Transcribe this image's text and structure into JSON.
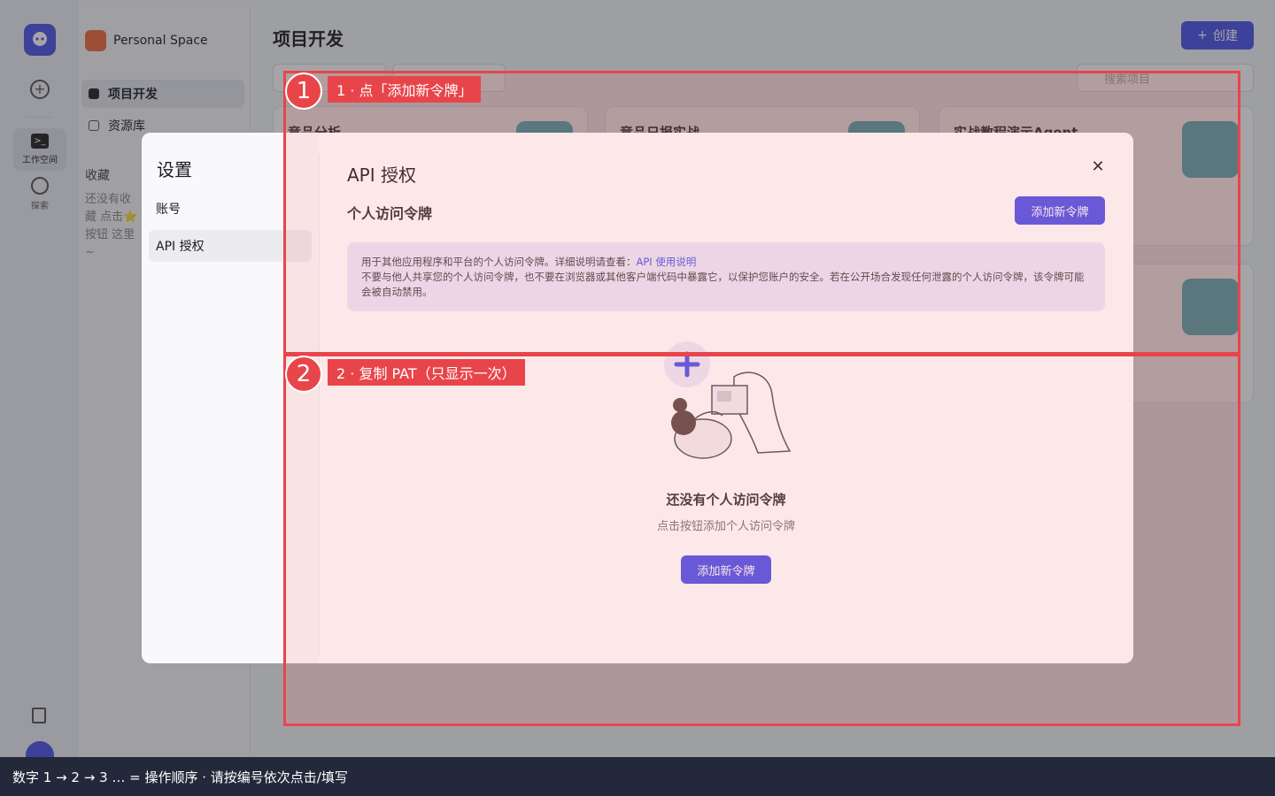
{
  "rail": {
    "workspace_label": "工作空间",
    "explore_label": "探索"
  },
  "sidebar": {
    "space_name": "Personal Space",
    "items": [
      {
        "label": "项目开发"
      },
      {
        "label": "资源库"
      }
    ],
    "favorites_title": "收藏",
    "favorites_empty": "还没有收藏 点击⭐按钮 这里~"
  },
  "main": {
    "title": "项目开发",
    "create_label": "创建",
    "search_placeholder": "搜索项目",
    "cards": [
      {
        "title": "竞品分析"
      },
      {
        "title": "竞品日报实战"
      },
      {
        "title": "实战教程演示Agent"
      }
    ]
  },
  "modal": {
    "title": "设置",
    "nav": [
      {
        "label": "账号"
      },
      {
        "label": "API 授权"
      }
    ],
    "section_title": "API 授权",
    "pat_title": "个人访问令牌",
    "add_label": "添加新令牌",
    "info_line1": "用于其他应用程序和平台的个人访问令牌。详细说明请查看：",
    "info_link": "API 使用说明",
    "info_line2": "不要与他人共享您的个人访问令牌，也不要在浏览器或其他客户端代码中暴露它，以保护您账户的安全。若在公开场合发现任何泄露的个人访问令牌，该令牌可能会被自动禁用。",
    "empty_title": "还没有个人访问令牌",
    "empty_sub": "点击按钮添加个人访问令牌",
    "empty_btn": "添加新令牌"
  },
  "annotations": [
    {
      "num": "1",
      "label": "1 ·  点「添加新令牌」"
    },
    {
      "num": "2",
      "label": "2 ·  复制 PAT（只显示一次）"
    }
  ],
  "bottom_bar": "数字 1 → 2 → 3 … = 操作顺序 ·   请按编号依次点击/填写",
  "colors": {
    "accent": "#4d53e8",
    "annotation": "#e8454b",
    "bottom_bar": "#23283a"
  }
}
